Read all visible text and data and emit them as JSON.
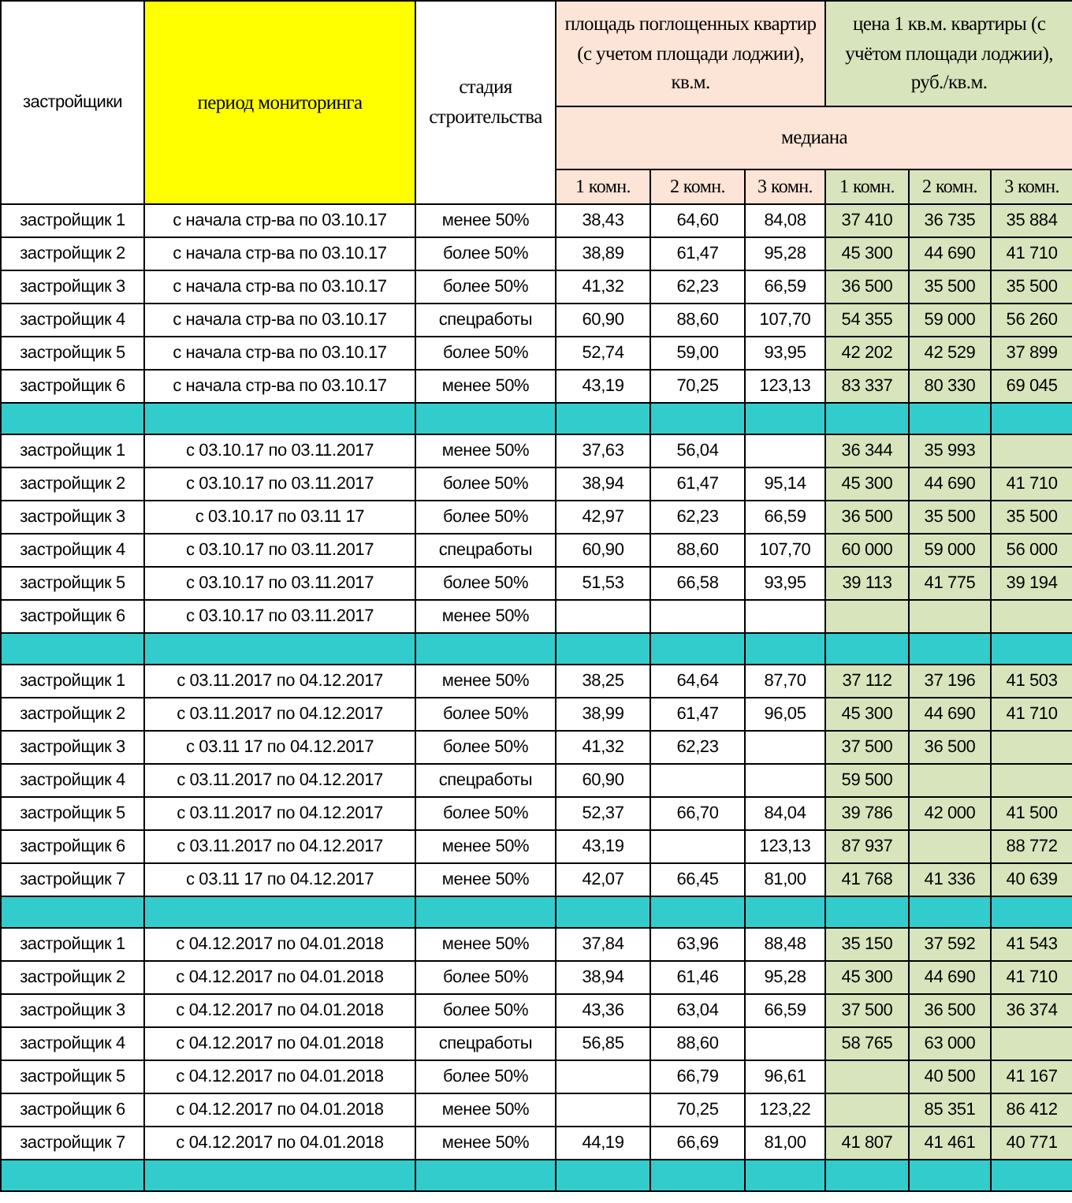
{
  "header": {
    "developers": "застройщики",
    "period": "период мониторинга",
    "stage": "стадия строительства",
    "area_title": "площадь поглощенных квартир (с учетом площади лоджии), кв.м.",
    "price_title": "цена 1 кв.м. квартиры (с учётом площади лоджии), руб./кв.м.",
    "median": "медиана",
    "room_labels": [
      "1 комн.",
      "2 комн.",
      "3 комн.",
      "1 комн.",
      "2 комн.",
      "3 комн."
    ]
  },
  "groups": [
    {
      "rows": [
        {
          "developer": "застройщик 1",
          "period": "с начала стр-ва по 03.10.17",
          "stage": "менее 50%",
          "area": {
            "room_1": "38,43",
            "room_2": "64,60",
            "room_3": "84,08"
          },
          "price": {
            "room_1": "37 410",
            "room_2": "36 735",
            "room_3": "35 884"
          }
        },
        {
          "developer": "застройщик 2",
          "period": "с начала стр-ва по 03.10.17",
          "stage": "более 50%",
          "area": {
            "room_1": "38,89",
            "room_2": "61,47",
            "room_3": "95,28"
          },
          "price": {
            "room_1": "45 300",
            "room_2": "44 690",
            "room_3": "41 710"
          }
        },
        {
          "developer": "застройщик 3",
          "period": "с начала стр-ва по 03.10.17",
          "stage": "более 50%",
          "area": {
            "room_1": "41,32",
            "room_2": "62,23",
            "room_3": "66,59"
          },
          "price": {
            "room_1": "36 500",
            "room_2": "35 500",
            "room_3": "35 500"
          }
        },
        {
          "developer": "застройщик 4",
          "period": "с начала стр-ва по 03.10.17",
          "stage": "спецработы",
          "area": {
            "room_1": "60,90",
            "room_2": "88,60",
            "room_3": "107,70"
          },
          "price": {
            "room_1": "54 355",
            "room_2": "59 000",
            "room_3": "56 260"
          }
        },
        {
          "developer": "застройщик 5",
          "period": "с начала стр-ва по 03.10.17",
          "stage": "более 50%",
          "area": {
            "room_1": "52,74",
            "room_2": "59,00",
            "room_3": "93,95"
          },
          "price": {
            "room_1": "42 202",
            "room_2": "42 529",
            "room_3": "37 899"
          }
        },
        {
          "developer": "застройщик 6",
          "period": "с начала стр-ва по 03.10.17",
          "stage": "менее 50%",
          "area": {
            "room_1": "43,19",
            "room_2": "70,25",
            "room_3": "123,13"
          },
          "price": {
            "room_1": "83 337",
            "room_2": "80 330",
            "room_3": "69 045"
          }
        }
      ]
    },
    {
      "rows": [
        {
          "developer": "застройщик 1",
          "period": "с 03.10.17 по 03.11.2017",
          "stage": "менее 50%",
          "area": {
            "room_1": "37,63",
            "room_2": "56,04"
          },
          "price": {
            "room_1": "36 344",
            "room_2": "35 993"
          }
        },
        {
          "developer": "застройщик 2",
          "period": "с 03.10.17 по 03.11.2017",
          "stage": "более 50%",
          "area": {
            "room_1": "38,94",
            "room_2": "61,47",
            "room_3": "95,14"
          },
          "price": {
            "room_1": "45 300",
            "room_2": "44 690",
            "room_3": "41 710"
          }
        },
        {
          "developer": "застройщик 3",
          "period": "с 03.10.17 по 03.11 17",
          "stage": "более 50%",
          "area": {
            "room_1": "42,97",
            "room_2": "62,23",
            "room_3": "66,59"
          },
          "price": {
            "room_1": "36 500",
            "room_2": "35 500",
            "room_3": "35 500"
          }
        },
        {
          "developer": "застройщик 4",
          "period": "с 03.10.17 по 03.11.2017",
          "stage": "спецработы",
          "area": {
            "room_1": "60,90",
            "room_2": "88,60",
            "room_3": "107,70"
          },
          "price": {
            "room_1": "60 000",
            "room_2": "59 000",
            "room_3": "56 000"
          }
        },
        {
          "developer": "застройщик 5",
          "period": "с 03.10.17 по 03.11.2017",
          "stage": "более 50%",
          "area": {
            "room_1": "51,53",
            "room_2": "66,58",
            "room_3": "93,95"
          },
          "price": {
            "room_1": "39 113",
            "room_2": "41 775",
            "room_3": "39 194"
          }
        },
        {
          "developer": "застройщик 6",
          "period": "с 03.10.17 по 03.11.2017",
          "stage": "менее 50%"
        }
      ]
    },
    {
      "rows": [
        {
          "developer": "застройщик 1",
          "period": "с 03.11.2017 по 04.12.2017",
          "stage": "менее 50%",
          "area": {
            "room_1": "38,25",
            "room_2": "64,64",
            "room_3": "87,70"
          },
          "price": {
            "room_1": "37 112",
            "room_2": "37 196",
            "room_3": "41 503"
          }
        },
        {
          "developer": "застройщик 2",
          "period": "с 03.11.2017 по 04.12.2017",
          "stage": "более 50%",
          "area": {
            "room_1": "38,99",
            "room_2": "61,47",
            "room_3": "96,05"
          },
          "price": {
            "room_1": "45 300",
            "room_2": "44 690",
            "room_3": "41 710"
          }
        },
        {
          "developer": "застройщик 3",
          "period": "с 03.11 17 по 04.12.2017",
          "stage": "более 50%",
          "area": {
            "room_1": "41,32",
            "room_2": "62,23"
          },
          "price": {
            "room_1": "37 500",
            "room_2": "36 500"
          }
        },
        {
          "developer": "застройщик 4",
          "period": "с 03.11.2017 по 04.12.2017",
          "stage": "спецработы",
          "area": {
            "room_1": "60,90"
          },
          "price": {
            "room_1": "59 500"
          }
        },
        {
          "developer": "застройщик 5",
          "period": "с 03.11.2017 по 04.12.2017",
          "stage": "более 50%",
          "area": {
            "room_1": "52,37",
            "room_2": "66,70",
            "room_3": "84,04"
          },
          "price": {
            "room_1": "39 786",
            "room_2": "42 000",
            "room_3": "41 500"
          }
        },
        {
          "developer": "застройщик 6",
          "period": "с 03.11.2017 по 04.12.2017",
          "stage": "менее 50%",
          "area": {
            "room_1": "43,19",
            "room_3": "123,13"
          },
          "price": {
            "room_1": "87 937",
            "room_3": "88 772"
          }
        },
        {
          "developer": "застройщик 7",
          "period": "с 03.11 17 по 04.12.2017",
          "stage": "менее 50%",
          "area": {
            "room_1": "42,07",
            "room_2": "66,45",
            "room_3": "81,00"
          },
          "price": {
            "room_1": "41 768",
            "room_2": "41 336",
            "room_3": "40 639"
          }
        }
      ]
    },
    {
      "rows": [
        {
          "developer": "застройщик 1",
          "period": "с 04.12.2017 по 04.01.2018",
          "stage": "менее 50%",
          "area": {
            "room_1": "37,84",
            "room_2": "63,96",
            "room_3": "88,48"
          },
          "price": {
            "room_1": "35 150",
            "room_2": "37 592",
            "room_3": "41 543"
          }
        },
        {
          "developer": "застройщик 2",
          "period": "с 04.12.2017 по 04.01.2018",
          "stage": "более 50%",
          "area": {
            "room_1": "38,94",
            "room_2": "61,46",
            "room_3": "95,28"
          },
          "price": {
            "room_1": "45 300",
            "room_2": "44 690",
            "room_3": "41 710"
          }
        },
        {
          "developer": "застройщик 3",
          "period": "с 04.12.2017 по 04.01.2018",
          "stage": "более 50%",
          "area": {
            "room_1": "43,36",
            "room_2": "63,04",
            "room_3": "66,59"
          },
          "price": {
            "room_1": "37 500",
            "room_2": "36 500",
            "room_3": "36 374"
          }
        },
        {
          "developer": "застройщик 4",
          "period": "с 04.12.2017 по 04.01.2018",
          "stage": "спецработы",
          "area": {
            "room_1": "56,85",
            "room_2": "88,60"
          },
          "price": {
            "room_1": "58 765",
            "room_2": "63 000"
          }
        },
        {
          "developer": "застройщик 5",
          "period": "с 04.12.2017 по 04.01.2018",
          "stage": "более 50%",
          "area": {
            "room_2": "66,79",
            "room_3": "96,61"
          },
          "price": {
            "room_2": "40 500",
            "room_3": "41 167"
          }
        },
        {
          "developer": "застройщик 6",
          "period": "с 04.12.2017 по 04.01.2018",
          "stage": "менее 50%",
          "area": {
            "room_2": "70,25",
            "room_3": "123,22"
          },
          "price": {
            "room_2": "85 351",
            "room_3": "86 412"
          }
        },
        {
          "developer": "застройщик 7",
          "period": "с 04.12.2017 по 04.01.2018",
          "stage": "менее 50%",
          "area": {
            "room_1": "44,19",
            "room_2": "66,69",
            "room_3": "81,00"
          },
          "price": {
            "room_1": "41 807",
            "room_2": "41 461",
            "room_3": "40 771"
          }
        }
      ]
    }
  ]
}
